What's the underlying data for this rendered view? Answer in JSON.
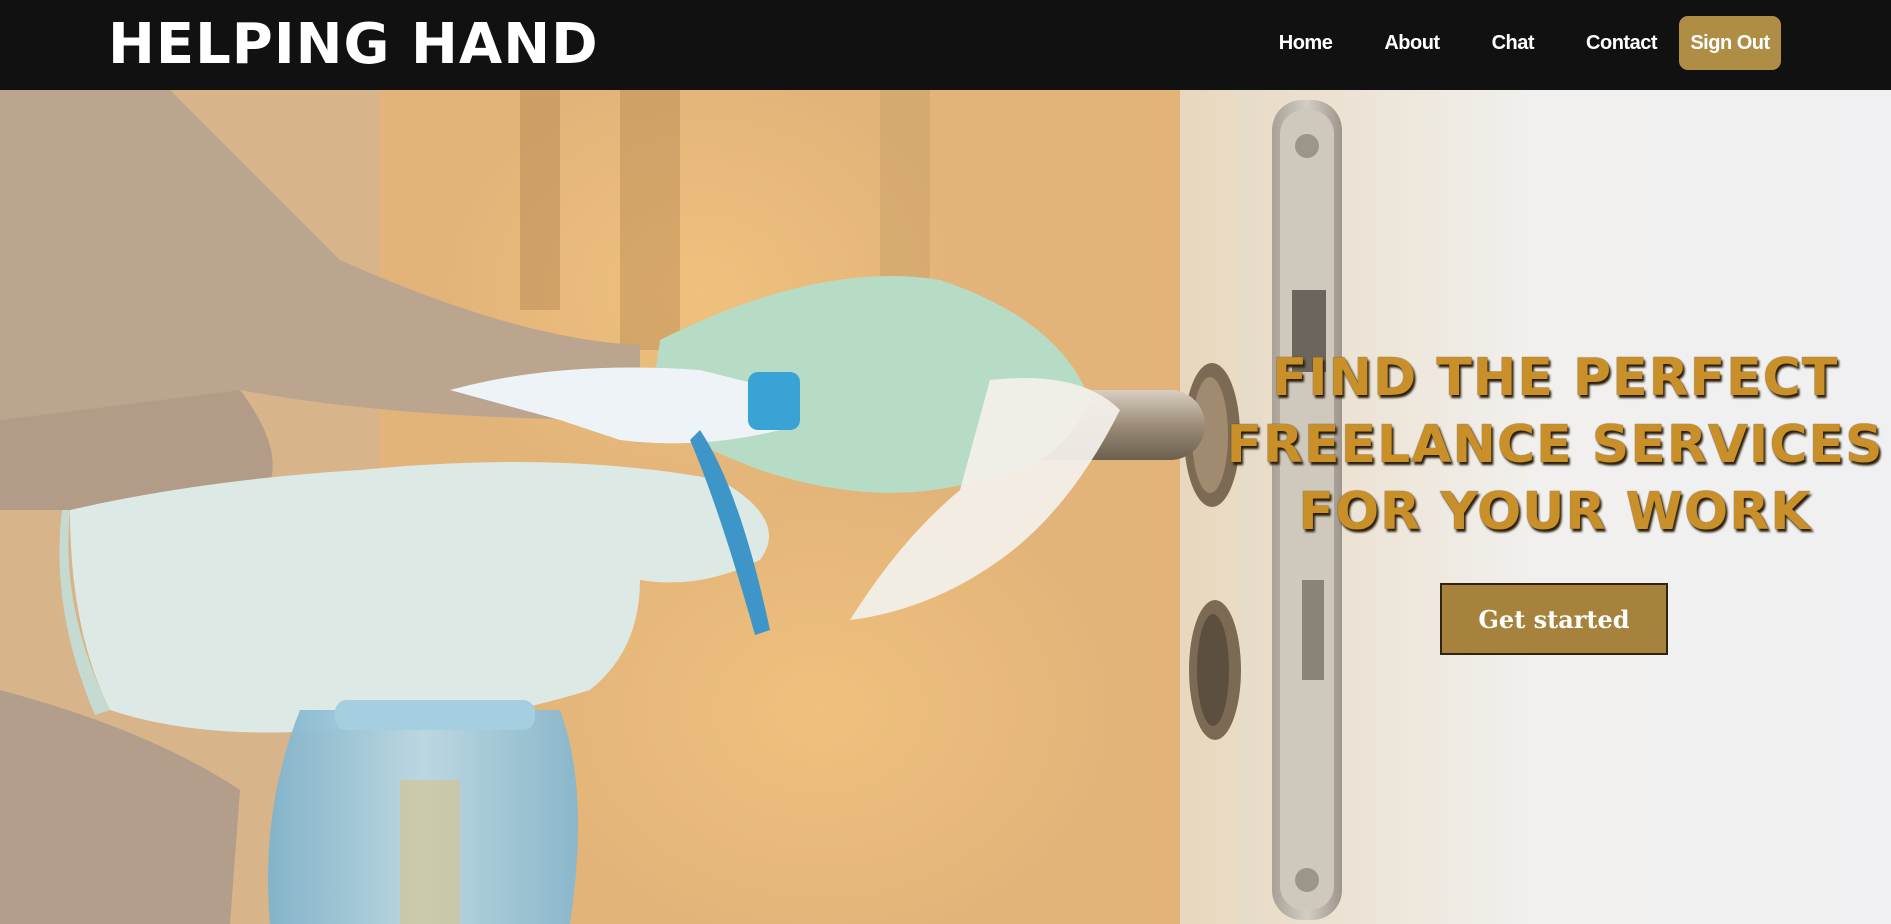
{
  "brand": {
    "name": "HELPING HAND"
  },
  "nav": {
    "links": [
      "Home",
      "About",
      "Chat",
      "Contact"
    ],
    "signout_label": "Sign Out"
  },
  "hero": {
    "headline_lines": [
      "FIND THE PERFECT",
      "FREELANCE SERVICES",
      "FOR YOUR WORK"
    ],
    "cta_label": "Get started",
    "image_subject": "gloved-hands-cleaning-door-handle-photo"
  },
  "colors": {
    "navbar_bg": "#111111",
    "accent": "#b08d45",
    "headline": "#c9902a",
    "button_bg": "#a7823d"
  }
}
